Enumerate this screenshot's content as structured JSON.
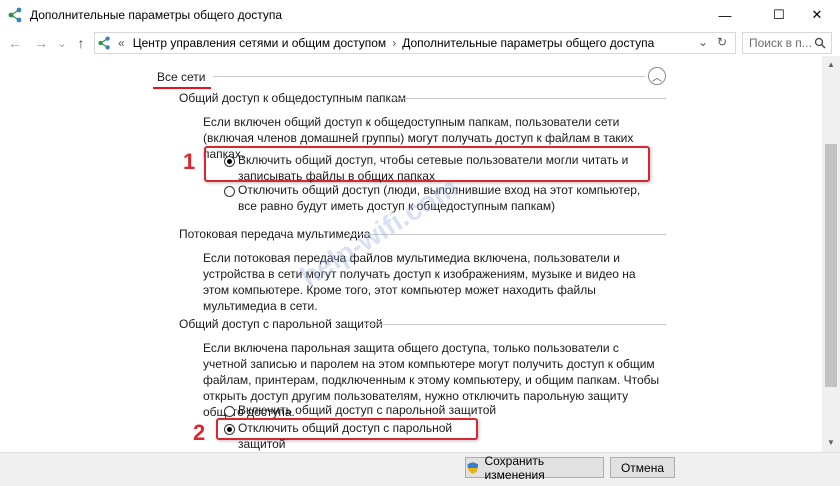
{
  "window": {
    "title": "Дополнительные параметры общего доступа",
    "minimize": "—",
    "maximize": "☐",
    "close": "✕"
  },
  "nav": {
    "back": "←",
    "forward": "→",
    "dropdown": "⌄",
    "up": "↑",
    "breadcrumb_sep": "«",
    "crumb1": "Центр управления сетями и общим доступом",
    "crumb_arrow": "›",
    "crumb2": "Дополнительные параметры общего доступа",
    "addr_dropdown": "⌄",
    "refresh": "↻",
    "search_placeholder": "Поиск в п..."
  },
  "section": {
    "title": "Все сети",
    "collapse": "︿"
  },
  "public_folders": {
    "title": "Общий доступ к общедоступным папкам",
    "desc": "Если включен общий доступ к общедоступным папкам, пользователи сети (включая членов домашней группы) могут получать доступ к файлам в таких папках.",
    "opt_on": "Включить общий доступ, чтобы сетевые пользователи могли читать и записывать файлы в общих папках",
    "opt_off": "Отключить общий доступ (люди, выполнившие вход на этот компьютер, все равно будут иметь доступ к общедоступным папкам)"
  },
  "media": {
    "title": "Потоковая передача мультимедиа",
    "desc": "Если потоковая передача файлов мультимедиа включена, пользователи и устройства в сети могут получать доступ к изображениям, музыке и видео на этом компьютере. Кроме того, этот компьютер может находить файлы мультимедиа в сети."
  },
  "password": {
    "title": "Общий доступ с парольной защитой",
    "desc": "Если включена парольная защита общего доступа, только пользователи с учетной записью и паролем на этом компьютере могут получить доступ к общим файлам, принтерам, подключенным к этому компьютеру, и общим папкам. Чтобы открыть доступ другим пользователям, нужно отключить парольную защиту общего доступа.",
    "opt_on": "Включить общий доступ с парольной защитой",
    "opt_off": "Отключить общий доступ с парольной защитой"
  },
  "annotations": {
    "n1": "1",
    "n2": "2",
    "watermark": "help-wifi.com"
  },
  "footer": {
    "save": "Сохранить изменения",
    "cancel": "Отмена"
  },
  "colors": {
    "accent_red": "#d9262f",
    "section_underline": "#e81123"
  }
}
